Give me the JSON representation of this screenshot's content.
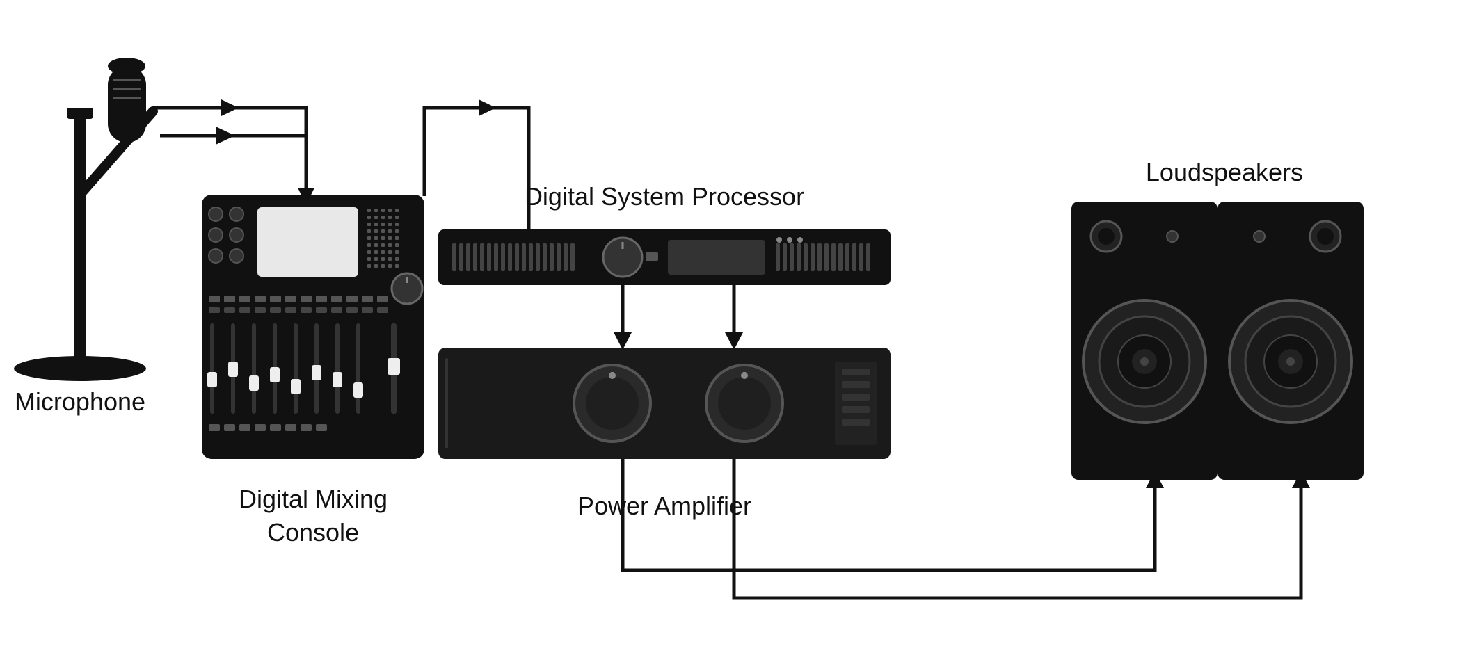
{
  "labels": {
    "microphone": "Microphone",
    "digital_mixing_console": "Digital Mixing",
    "console": "Console",
    "digital_system_processor": "Digital System Processor",
    "power_amplifier": "Power Amplifier",
    "loudspeakers": "Loudspeakers"
  },
  "colors": {
    "black": "#111111",
    "white": "#ffffff",
    "bg": "#ffffff"
  }
}
